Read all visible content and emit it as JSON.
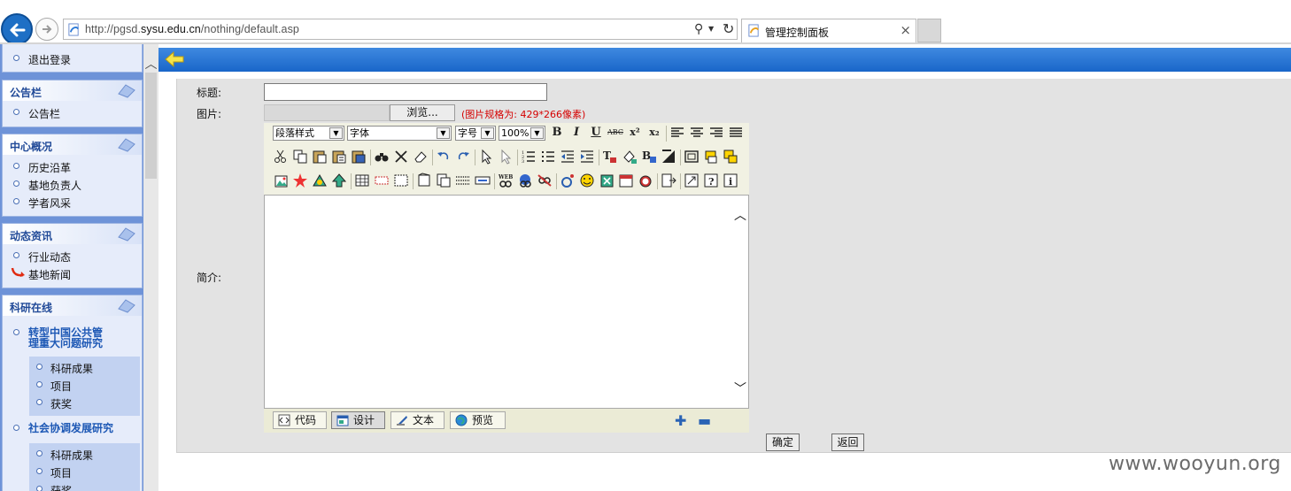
{
  "browser": {
    "url_prefix": "http://pgsd.",
    "url_domain": "sysu.edu.cn",
    "url_path": "/nothing/default.asp",
    "tab_title": "管理控制面板",
    "tab_close": "×",
    "search_glyph": "⚲",
    "dropdown_glyph": "▼",
    "refresh_glyph": "↻"
  },
  "sidebar": {
    "top_items": [
      {
        "label": "退出登录"
      }
    ],
    "panels": [
      {
        "title": "公告栏",
        "items": [
          {
            "label": "公告栏"
          }
        ]
      },
      {
        "title": "中心概况",
        "items": [
          {
            "label": "历史沿革"
          },
          {
            "label": "基地负责人"
          },
          {
            "label": "学者风采"
          }
        ]
      },
      {
        "title": "动态资讯",
        "items": [
          {
            "label": "行业动态"
          },
          {
            "label": "基地新闻"
          }
        ]
      },
      {
        "title": "科研在线",
        "groups": [
          {
            "title_line1": "转型中国公共管",
            "title_line2": "理重大问题研究",
            "items": [
              {
                "label": "科研成果"
              },
              {
                "label": "项目"
              },
              {
                "label": "获奖"
              }
            ]
          },
          {
            "title_line1": "社会协调发展研究",
            "items": [
              {
                "label": "科研成果"
              },
              {
                "label": "项目"
              },
              {
                "label": "获奖"
              }
            ]
          }
        ]
      }
    ],
    "scroll_up_glyph": "︿"
  },
  "form": {
    "title_label": "标题:",
    "title_value": "",
    "image_label": "图片:",
    "browse_label": "浏览...",
    "image_hint": "(图片规格为: 429*266像素)",
    "intro_label": "简介:",
    "confirm_label": "确定",
    "back_label": "返回"
  },
  "editor": {
    "paragraph_style": "段落样式",
    "font": "字体",
    "font_size": "字号",
    "zoom": "100%",
    "dd_glyph": "▼",
    "format_buttons": [
      "B",
      "I",
      "U",
      "ABC",
      "x²",
      "x₂"
    ],
    "scroll_up_glyph": "︿",
    "scroll_down_glyph": "﹀",
    "modes": [
      {
        "label": "代码",
        "icon": "code-icon"
      },
      {
        "label": "设计",
        "icon": "design-icon",
        "active": true
      },
      {
        "label": "文本",
        "icon": "text-icon"
      },
      {
        "label": "预览",
        "icon": "preview-icon"
      }
    ],
    "plus_glyph": "✚",
    "minus_glyph": "▬"
  },
  "watermark": "www.wooyun.org",
  "colors": {
    "sidebar_bg": "#6e93d8",
    "topbar_blue": "#1966c9",
    "panel_title": "#214a98",
    "hint_red": "#d50000"
  }
}
